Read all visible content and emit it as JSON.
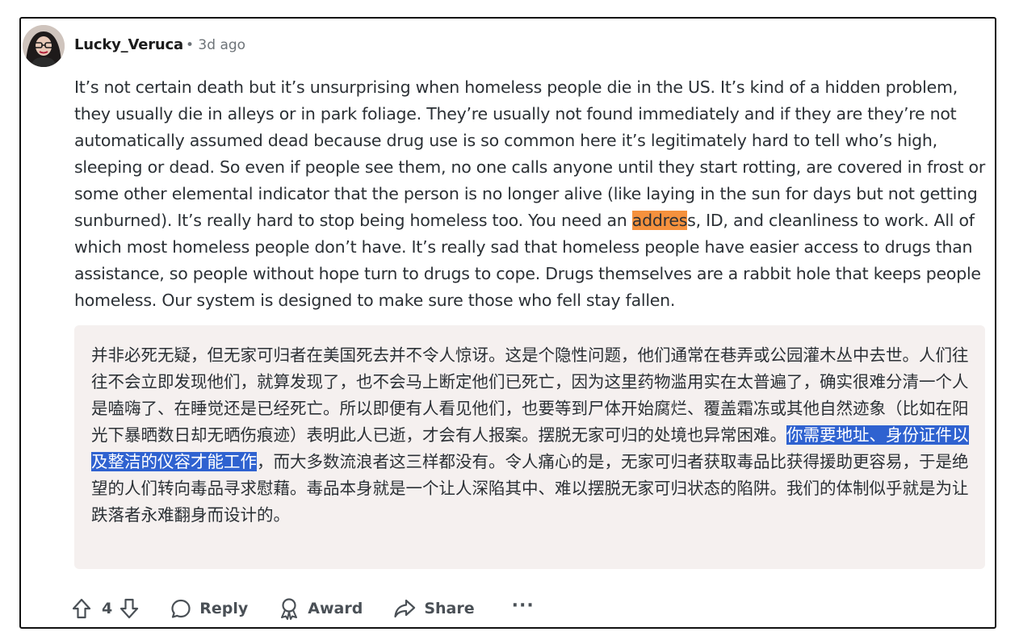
{
  "comment": {
    "author": "Lucky_Veruca",
    "time": "• 3d ago",
    "body_before": "It’s not certain death but it’s unsurprising when homeless people die in the US. It’s kind of a hidden problem, they usually die in alleys or in park foliage. They’re usually not found immediately and if they are they’re not automatically assumed dead because drug use is so common here it’s legitimately hard to tell who’s high, sleeping or dead. So even if people see them, no one calls anyone until they start rotting, are covered in frost or some other elemental indicator that the person is no longer alive (like laying in the sun for days but not getting sunburned). It’s really hard to stop being homeless too. You need an ",
    "body_highlight": "addres",
    "body_after": "s, ID, and cleanliness to work. All of which most homeless people don’t have. It’s really sad that homeless people have easier access to drugs than assistance, so people without hope turn to drugs to cope. Drugs themselves are a rabbit hole that keeps people homeless. Our system is designed to make sure those who fell stay fallen."
  },
  "translation": {
    "before": "并非必死无疑，但无家可归者在美国死去并不令人惊讶。这是个隐性问题，他们通常在巷弄或公园灌木丛中去世。人们往往不会立即发现他们，就算发现了，也不会马上断定他们已死亡，因为这里药物滥用实在太普遍了，确实很难分清一个人是嗑嗨了、在睡觉还是已经死亡。所以即便有人看见他们，也要等到尸体开始腐烂、覆盖霜冻或其他自然迹象（比如在阳光下暴晒数日却无晒伤痕迹）表明此人已逝，才会有人报案。摆脱无家可归的处境也异常困难。",
    "selected": "你需要地址、身份证件以及整洁的仪容才能工作",
    "after": "，而大多数流浪者这三样都没有。令人痛心的是，无家可归者获取毒品比获得援助更容易，于是绝望的人们转向毒品寻求慰藉。毒品本身就是一个让人深陷其中、难以摆脱无家可归状态的陷阱。我们的体制似乎就是为让跌落者永难翻身而设计的。"
  },
  "actions": {
    "vote_count": "4",
    "reply_label": "Reply",
    "award_label": "Award",
    "share_label": "Share",
    "more_label": "···"
  },
  "icons": {
    "upvote": "arrow-up-icon",
    "downvote": "arrow-down-icon",
    "reply": "speech-bubble-icon",
    "award": "award-ribbon-icon",
    "share": "share-arrow-icon",
    "more": "ellipsis-icon"
  },
  "colors": {
    "text_highlight": "#f5913d",
    "selection": "#2f62d0",
    "translation_bg": "#f5f0ef"
  }
}
